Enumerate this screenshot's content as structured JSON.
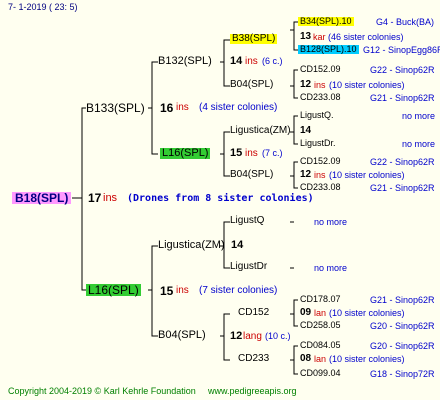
{
  "header": {
    "date": "7-   1-2019  ( 23:   5)"
  },
  "root": {
    "name": "B18(SPL)",
    "num": "17",
    "unit": "ins",
    "note": "(Drones from 8 sister colonies)"
  },
  "g1": [
    {
      "name": "B133(SPL)",
      "num": "16",
      "unit": "ins",
      "note": "(4 sister colonies)"
    },
    {
      "name": "L16(SPL)",
      "num": "15",
      "unit": "ins",
      "note": "(7 sister colonies)"
    }
  ],
  "g2": [
    {
      "name": "B132(SPL)",
      "num": "14",
      "unit": "ins",
      "note": "(6 c.)"
    },
    {
      "name": "L16(SPL)",
      "num": "15",
      "unit": "ins",
      "note": "(7 c.)"
    },
    {
      "name": "Ligustica(ZM)",
      "num": "14",
      "unit": "",
      "note": ""
    },
    {
      "name": "B04(SPL)",
      "num": "12",
      "unit": "lang",
      "note": "(10 c.)"
    }
  ],
  "g3": [
    {
      "name": "B38(SPL)",
      "num": "13",
      "unit": "kar",
      "note": "(46 sister colonies)"
    },
    {
      "name": "B04(SPL)",
      "num": "12",
      "unit": "ins",
      "note": "(10 sister colonies)"
    },
    {
      "name": "Ligustica(ZM)",
      "num": "14",
      "unit": "",
      "note": ""
    },
    {
      "name": "B04(SPL)",
      "num": "12",
      "unit": "ins",
      "note": "(10 sister colonies)"
    },
    {
      "name": "LigustQ",
      "num": "",
      "unit": "",
      "note": ""
    },
    {
      "name": "LigustDr",
      "num": "",
      "unit": "",
      "note": ""
    },
    {
      "name": "CD152",
      "num": "09",
      "unit": "lan",
      "note": "(10 sister colonies)"
    },
    {
      "name": "CD233",
      "num": "08",
      "unit": "lan",
      "note": "(10 sister colonies)"
    }
  ],
  "g4": [
    {
      "name": "B34(SPL).10",
      "tag": "G4 - Buck(BA)"
    },
    {
      "name": "B128(SPL).10",
      "tag": "G12 - SinopEgg86R"
    },
    {
      "name": "CD152.09",
      "tag": "G22 - Sinop62R"
    },
    {
      "name": "CD233.08",
      "tag": "G21 - Sinop62R"
    },
    {
      "name": "LigustQ.",
      "tag": "no more"
    },
    {
      "name": "LigustDr.",
      "tag": "no more"
    },
    {
      "name": "CD152.09",
      "tag": "G22 - Sinop62R"
    },
    {
      "name": "CD233.08",
      "tag": "G21 - Sinop62R"
    },
    {
      "name": "",
      "tag": "no more"
    },
    {
      "name": "",
      "tag": "no more"
    },
    {
      "name": "CD178.07",
      "tag": "G21 - Sinop62R"
    },
    {
      "name": "CD258.05",
      "tag": "G20 - Sinop62R"
    },
    {
      "name": "CD084.05",
      "tag": "G20 - Sinop62R"
    },
    {
      "name": "CD099.04",
      "tag": "G18 - Sinop72R"
    }
  ],
  "footer": {
    "copyright": "Copyright 2004-2019 © Karl Kehrle Foundation",
    "site": "www.pedigreeapis.org"
  },
  "colors": {
    "background": "#fffff0",
    "lines": "#000000",
    "hl_yellow": "#ffff00",
    "hl_green": "#33cc33",
    "hl_cyan": "#00ccff",
    "hl_pink": "#ff99ff"
  }
}
